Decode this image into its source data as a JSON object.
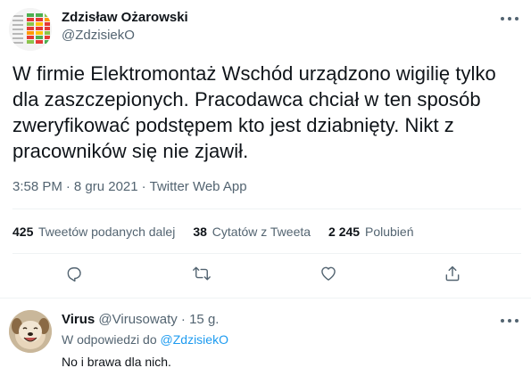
{
  "tweet": {
    "author_name": "Zdzisław Ożarowski",
    "author_handle": "@ZdzisiekO",
    "text": "W firmie Elektromontaż Wschód urządzono wigilię tylko dla zaszczepionych. Pracodawca chciał w ten sposób zweryfikować podstępem kto jest dziabnięty. Nikt z pracowników się nie zjawił.",
    "time": "3:58 PM",
    "date": "8 gru 2021",
    "source": "Twitter Web App",
    "separator": "·"
  },
  "stats": {
    "retweets_count": "425",
    "retweets_label": "Tweetów podanych dalej",
    "quotes_count": "38",
    "quotes_label": "Cytatów z Tweeta",
    "likes_count": "2 245",
    "likes_label": "Polubień"
  },
  "actions": {
    "reply_icon": "reply-icon",
    "retweet_icon": "retweet-icon",
    "like_icon": "heart-icon",
    "share_icon": "share-icon"
  },
  "reply": {
    "name": "Virus",
    "handle": "@Virusowaty",
    "separator": "·",
    "time_ago": "15 g.",
    "replying_prefix": "W odpowiedzi do",
    "replying_handle": "@ZdzisiekO",
    "text": "No i brawa dla nich."
  },
  "colors": {
    "text_primary": "#0f1419",
    "text_secondary": "#536471",
    "link": "#1d9bf0",
    "divider": "#eff3f4"
  }
}
